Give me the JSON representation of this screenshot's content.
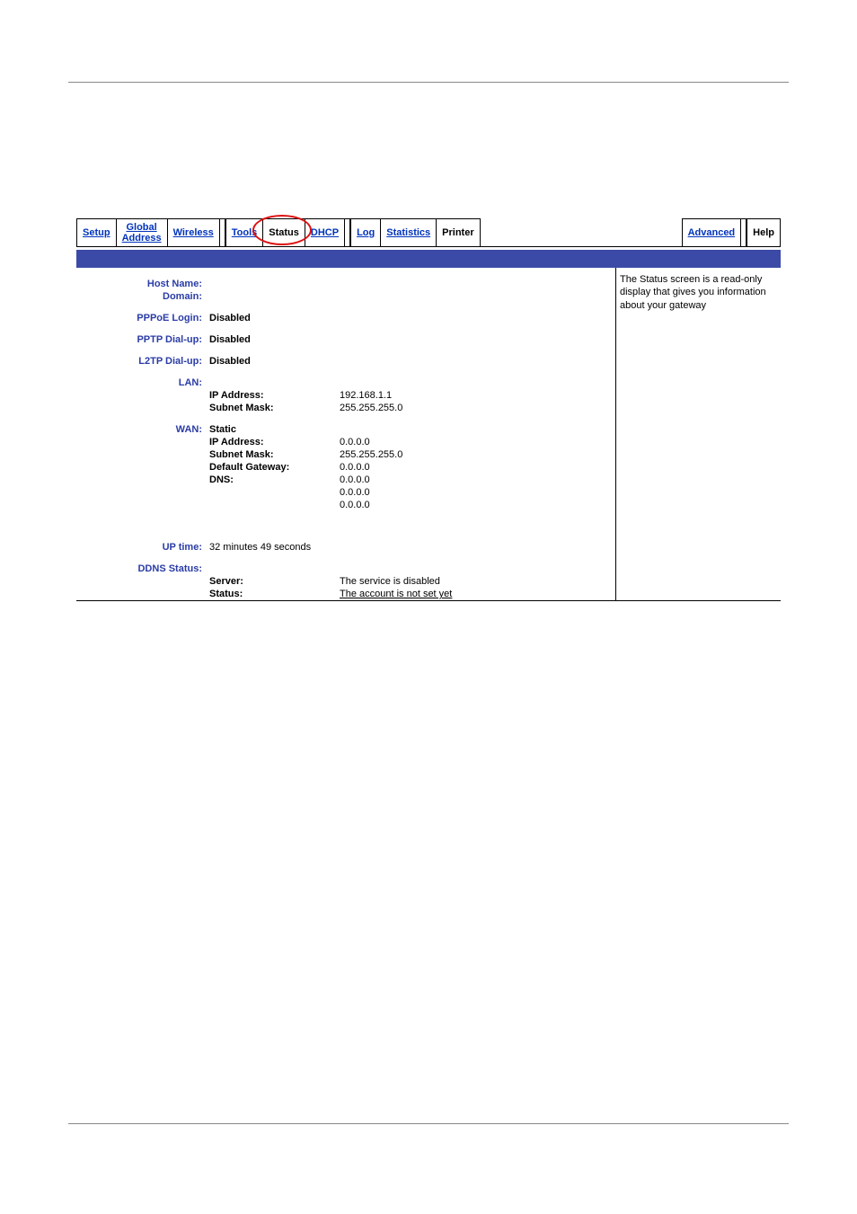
{
  "tabs": {
    "setup": "Setup",
    "global1": "Global",
    "global2": "Address",
    "wireless": "Wireless",
    "tools": "Tools",
    "status": "Status",
    "dhcp": "DHCP",
    "log": "Log",
    "statistics": "Statistics",
    "printer": "Printer",
    "advanced": "Advanced",
    "help": "Help"
  },
  "labels": {
    "hostname": "Host Name:",
    "domain": "Domain:",
    "pppoe": "PPPoE Login:",
    "pptp": "PPTP Dial-up:",
    "l2tp": "L2TP Dial-up:",
    "lan": "LAN:",
    "wan": "WAN:",
    "uptime": "UP time:",
    "ddns": "DDNS Status:"
  },
  "fields": {
    "ip_address": "IP Address:",
    "subnet_mask": "Subnet Mask:",
    "default_gw": "Default Gateway:",
    "dns": "DNS:",
    "static": "Static",
    "server": "Server:",
    "status": "Status:"
  },
  "values": {
    "disabled": "Disabled",
    "lan_ip": "192.168.1.1",
    "lan_mask": "255.255.255.0",
    "wan_ip": "0.0.0.0",
    "wan_mask": "255.255.255.0",
    "wan_gw": "0.0.0.0",
    "dns1": "0.0.0.0",
    "dns2": "0.0.0.0",
    "dns3": "0.0.0.0",
    "uptime": "32 minutes 49 seconds",
    "ddns_server": "The service is disabled",
    "ddns_status": "The account is not set yet"
  },
  "sidebar": "The Status screen is a read-only display that gives you information about your gateway"
}
